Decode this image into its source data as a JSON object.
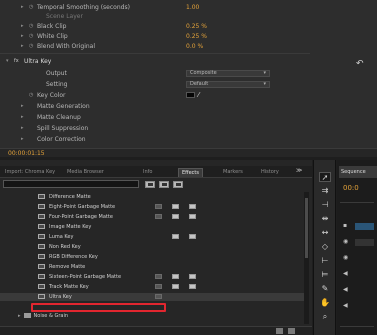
{
  "effect_controls": {
    "rows": [
      {
        "label": "Temporal Smoothing (seconds)",
        "value": "1.00",
        "indent": 1
      },
      {
        "label": "Scene Layer",
        "value": "",
        "indent": 2
      },
      {
        "label": "Black Clip",
        "value": "0.25 %",
        "indent": 1
      },
      {
        "label": "White Clip",
        "value": "0.25 %",
        "indent": 1
      },
      {
        "label": "Blend With Original",
        "value": "0.0 %",
        "indent": 1
      }
    ],
    "ultra_key_title": "Ultra Key",
    "output_label": "Output",
    "output_value": "Composite",
    "setting_label": "Setting",
    "setting_value": "Default",
    "key_color_label": "Key Color",
    "subsections": [
      "Matte Generation",
      "Matte Cleanup",
      "Spill Suppression",
      "Color Correction"
    ],
    "timecode": "00:00:01:15"
  },
  "effects_panel": {
    "tabs": [
      "Import: Chroma Key",
      "Media Browser",
      "Info",
      "Effects",
      "Markers",
      "History"
    ],
    "active_tab": "Effects",
    "search_value": "",
    "items": [
      "Difference Matte",
      "Eight-Point Garbage Matte",
      "Four-Point Garbage Matte",
      "Image Matte Key",
      "Luma Key",
      "Non Red Key",
      "RGB Difference Key",
      "Remove Matte",
      "Sixteen-Point Garbage Matte",
      "Track Matte Key",
      "Ultra Key"
    ],
    "selected_item": "Ultra Key",
    "folder_label": "Noise & Grain"
  },
  "tools": [
    "selection-tool",
    "track-select-tool",
    "ripple-edit-tool",
    "rolling-edit-tool",
    "rate-stretch-tool",
    "razor-tool",
    "slip-tool",
    "slide-tool",
    "pen-tool",
    "hand-tool",
    "zoom-tool"
  ],
  "program_monitor": {
    "tab_label": "Sequence",
    "timecode": "00:0"
  }
}
